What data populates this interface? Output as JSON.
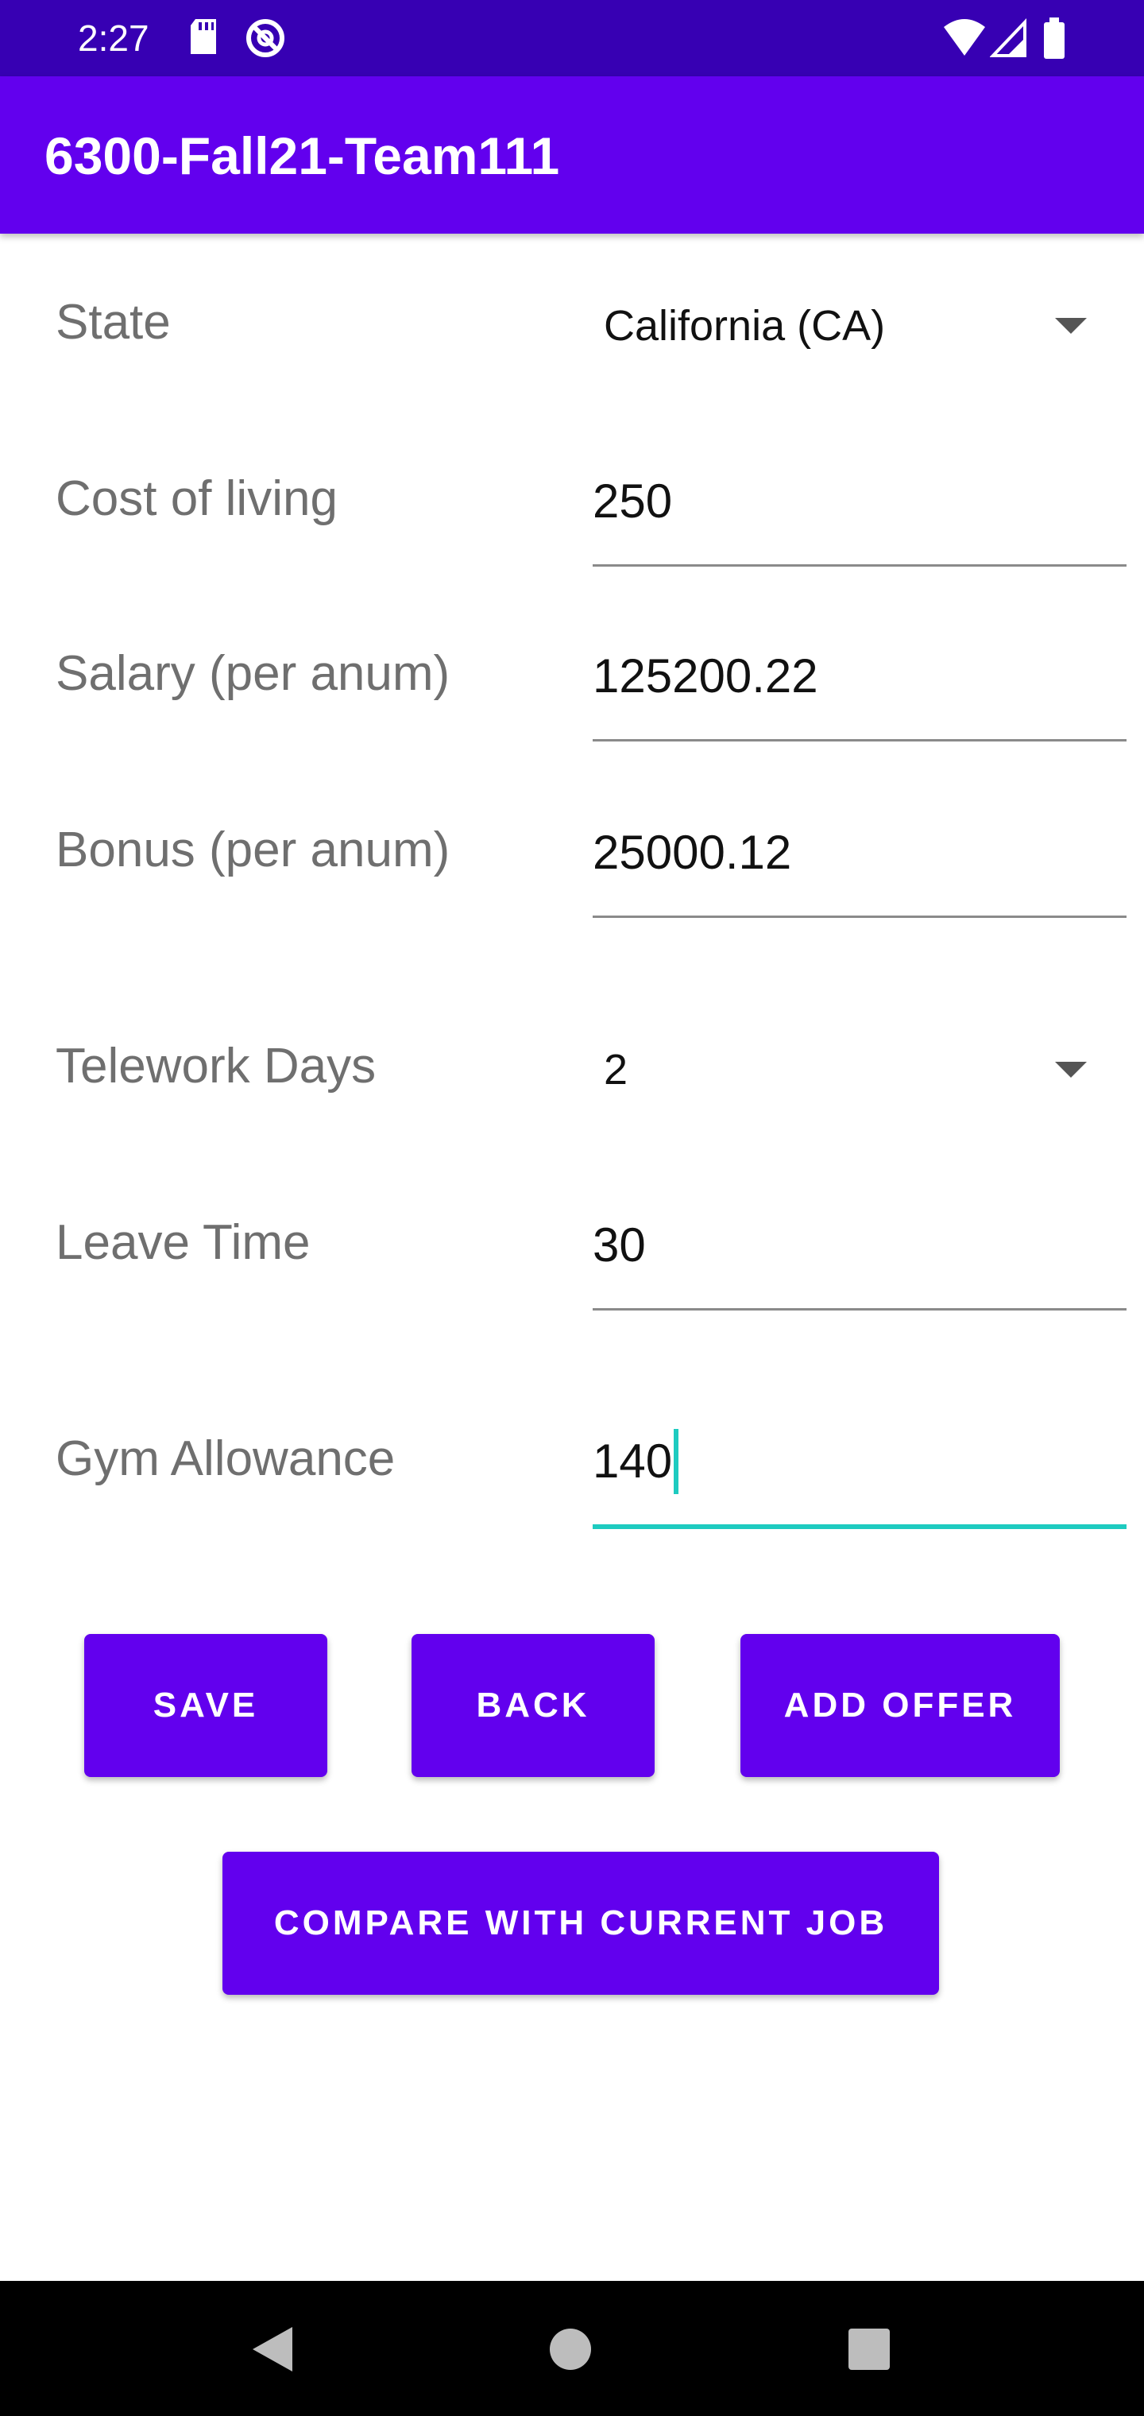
{
  "status_bar": {
    "time": "2:27",
    "icons": [
      "sd-card-icon",
      "no-entry-icon",
      "wifi-icon",
      "signal-icon",
      "battery-icon"
    ]
  },
  "app_bar": {
    "title": "6300-Fall21-Team111"
  },
  "form": {
    "state": {
      "label": "State",
      "value": "California (CA)"
    },
    "cost_of_living": {
      "label": "Cost of living",
      "value": "250"
    },
    "salary": {
      "label": "Salary (per anum)",
      "value": "125200.22"
    },
    "bonus": {
      "label": "Bonus (per anum)",
      "value": "25000.12"
    },
    "telework_days": {
      "label": "Telework Days",
      "value": "2"
    },
    "leave_time": {
      "label": "Leave Time",
      "value": "30"
    },
    "gym_allowance": {
      "label": "Gym Allowance",
      "value": "140"
    }
  },
  "buttons": {
    "save": "SAVE",
    "back": "BACK",
    "add_offer": "ADD OFFER",
    "compare": "COMPARE WITH CURRENT JOB"
  },
  "colors": {
    "status_bar": "#3700b3",
    "app_bar": "#6200ee",
    "button": "#6200ee",
    "focus_accent": "#1ecbc0"
  }
}
